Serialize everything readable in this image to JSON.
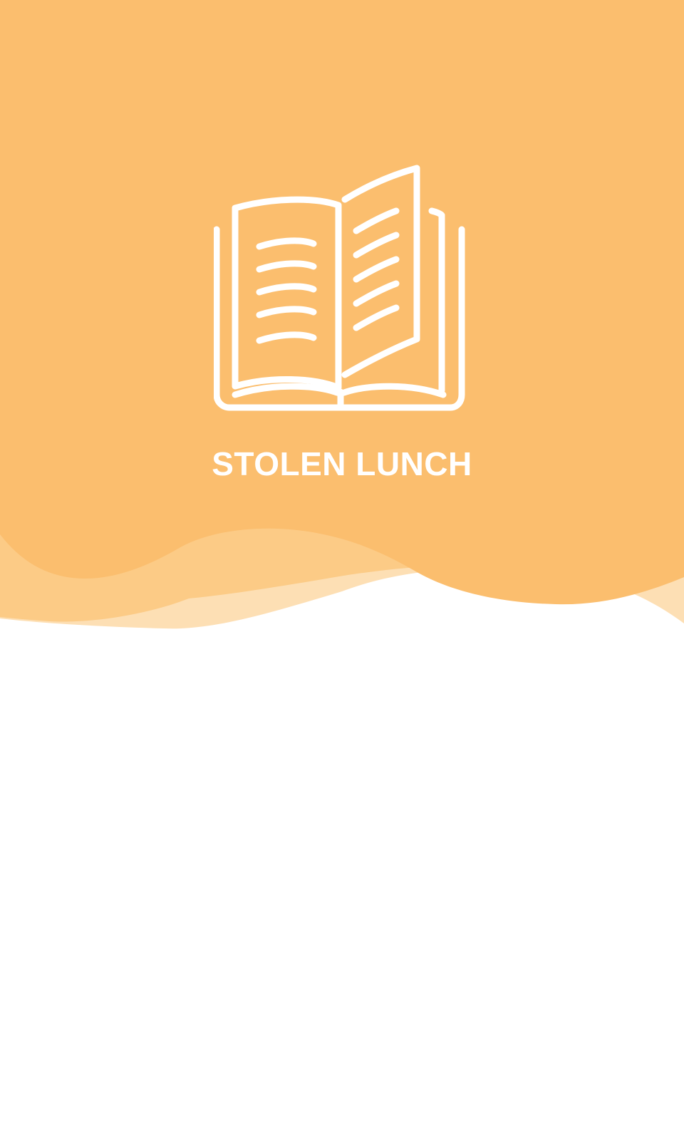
{
  "app": {
    "title": "STOLEN LUNCH"
  },
  "icons": {
    "logo": "open-book-icon"
  },
  "colors": {
    "primary": "#FBBE6E",
    "wave_light": "#FCCB86",
    "wave_lighter": "#FDDFB4",
    "text": "#FFFFFF",
    "background": "#FFFFFF"
  }
}
